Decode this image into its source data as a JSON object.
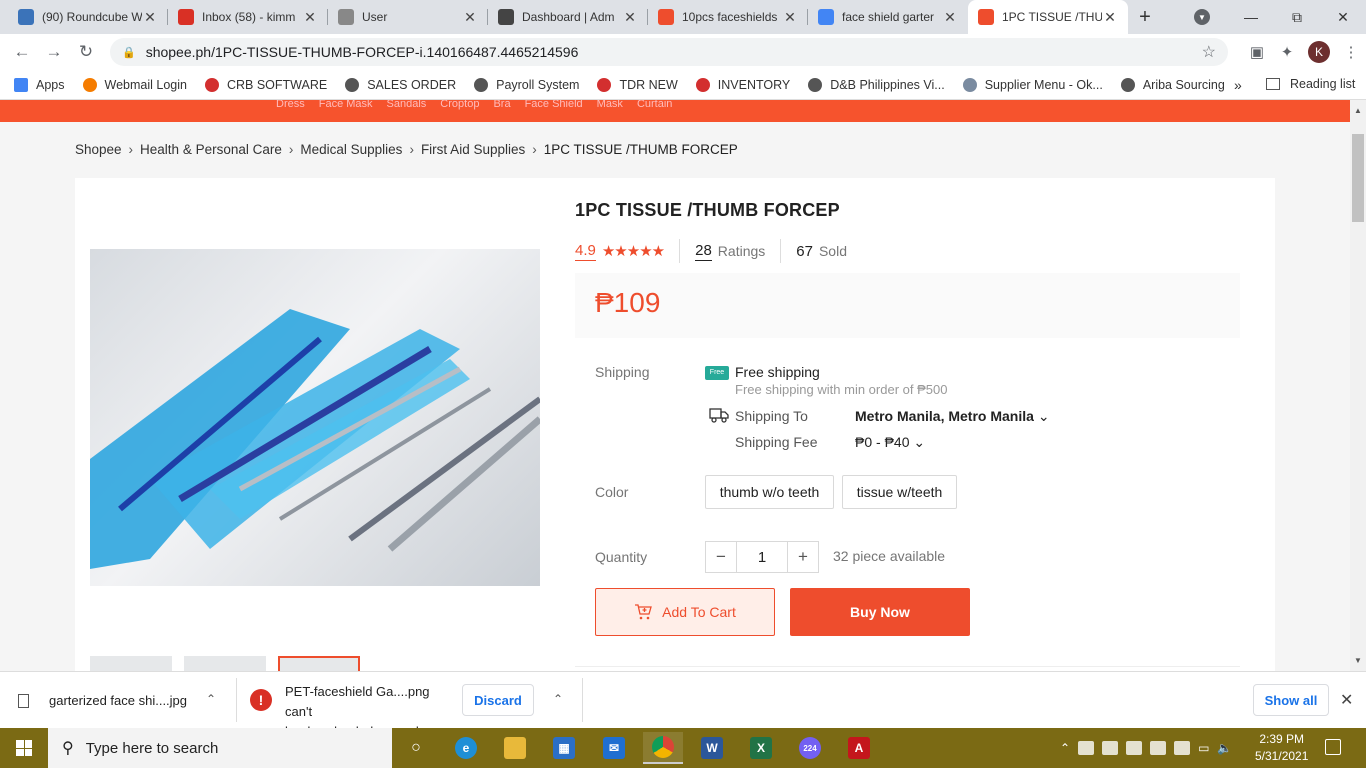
{
  "browser": {
    "tabs": [
      {
        "title": "(90) Roundcube W",
        "icon": "roundcube-icon",
        "color": "#3b73b9"
      },
      {
        "title": "Inbox (58) - kimm",
        "icon": "gmail-icon",
        "color": "#d93025"
      },
      {
        "title": "User",
        "icon": "loading-icon",
        "color": "#888888"
      },
      {
        "title": "Dashboard | Adm",
        "icon": "dashboard-icon",
        "color": "#444444"
      },
      {
        "title": "10pcs faceshields",
        "icon": "shopee-icon",
        "color": "#ee4d2d"
      },
      {
        "title": "face shield garter",
        "icon": "google-icon",
        "color": "#4285f4"
      },
      {
        "title": "1PC TISSUE /THU",
        "icon": "shopee-icon",
        "color": "#ee4d2d"
      }
    ],
    "url": "shopee.ph/1PC-TISSUE-THUMB-FORCEP-i.140166487.4465214596",
    "profile_initial": "K",
    "bookmarks": [
      {
        "label": "Apps",
        "color": "#4285f4"
      },
      {
        "label": "Webmail Login",
        "color": "#f57c00"
      },
      {
        "label": "CRB SOFTWARE",
        "color": "#d32f2f"
      },
      {
        "label": "SALES ORDER",
        "color": "#555555"
      },
      {
        "label": "Payroll System",
        "color": "#555555"
      },
      {
        "label": "TDR NEW",
        "color": "#d32f2f"
      },
      {
        "label": "INVENTORY",
        "color": "#d32f2f"
      },
      {
        "label": "D&B Philippines Vi...",
        "color": "#555555"
      },
      {
        "label": "Supplier Menu - Ok...",
        "color": "#7a8ba0"
      },
      {
        "label": "Ariba Sourcing",
        "color": "#555555"
      }
    ],
    "bookmarks_more": "»",
    "reading_list": "Reading list"
  },
  "page": {
    "categories": [
      "Dress",
      "Face Mask",
      "Sandals",
      "Croptop",
      "Bra",
      "Face Shield",
      "Mask",
      "Curtain"
    ],
    "breadcrumb": [
      "Shopee",
      "Health & Personal Care",
      "Medical Supplies",
      "First Aid Supplies"
    ],
    "breadcrumb_current": "1PC TISSUE /THUMB FORCEP",
    "product": {
      "title": "1PC TISSUE /THUMB FORCEP",
      "rating": "4.9",
      "stars": "★★★★★",
      "ratings_count": "28",
      "ratings_label": "Ratings",
      "sold_count": "67",
      "sold_label": "Sold",
      "price": "₱109",
      "shipping_label": "Shipping",
      "free_badge": "Free",
      "free_shipping": "Free shipping",
      "free_shipping_note": "Free shipping with min order of ₱500",
      "shipping_to_label": "Shipping To",
      "shipping_to_value": "Metro Manila, Metro Manila",
      "shipping_fee_label": "Shipping Fee",
      "shipping_fee_value": "₱0 - ₱40",
      "color_label": "Color",
      "colors": [
        "thumb w/o teeth",
        "tissue w/teeth"
      ],
      "quantity_label": "Quantity",
      "quantity": "1",
      "available": "32 piece available",
      "add_to_cart": "Add To Cart",
      "buy_now": "Buy Now",
      "accent": "#ee4d2d"
    }
  },
  "downloads": {
    "item1": "garterized face shi....jpg",
    "item2_line1": "PET-faceshield Ga....png can't",
    "item2_line2": "be downloaded securely",
    "discard": "Discard",
    "show_all": "Show all"
  },
  "taskbar": {
    "search_placeholder": "Type here to search",
    "time": "2:39 PM",
    "date": "5/31/2021",
    "viber_badge": "224"
  }
}
